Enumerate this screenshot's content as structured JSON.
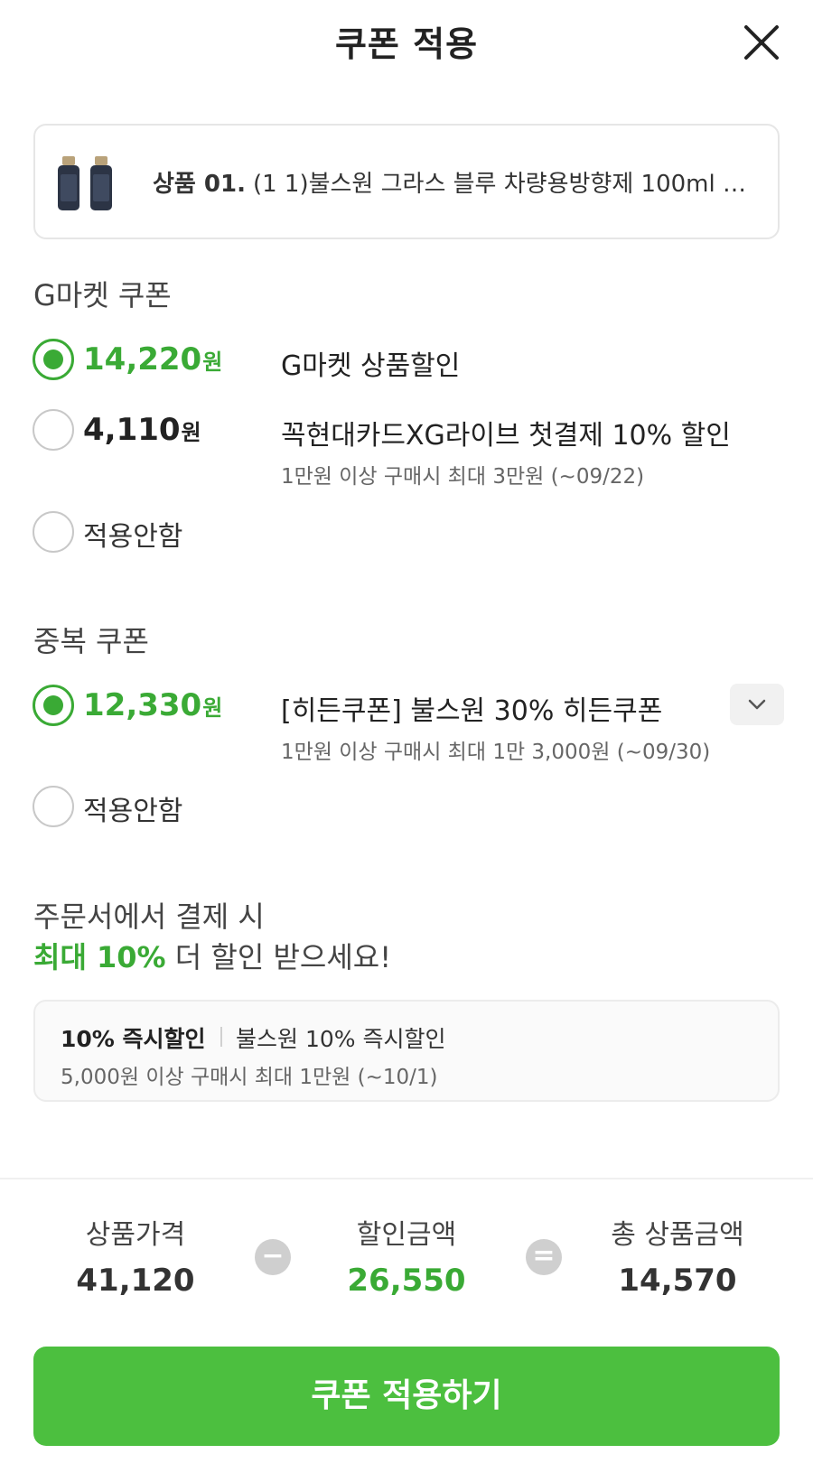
{
  "header": {
    "title": "쿠폰 적용"
  },
  "product": {
    "number": "상품 01.",
    "name": "(1 1)불스원 그라스 블루 차량용방향제 100ml 향..."
  },
  "gmarket_section": {
    "title": "G마켓 쿠폰",
    "options": [
      {
        "amount": "14,220",
        "unit": "원",
        "name": "G마켓 상품할인",
        "sub": "",
        "selected": true
      },
      {
        "amount": "4,110",
        "unit": "원",
        "name": "꼭현대카드XG라이브 첫결제 10% 할인",
        "sub": "1만원 이상 구매시 최대 3만원 (~09/22)",
        "selected": false
      }
    ],
    "none_label": "적용안함"
  },
  "duplicate_section": {
    "title": "중복 쿠폰",
    "options": [
      {
        "amount": "12,330",
        "unit": "원",
        "name": "[히든쿠폰] 불스원 30% 히든쿠폰",
        "sub": "1만원 이상 구매시 최대 1만 3,000원 (~09/30)",
        "selected": true
      }
    ],
    "none_label": "적용안함"
  },
  "promo": {
    "line1": "주문서에서 결제 시",
    "highlight": "최대 10%",
    "line2_rest": " 더 할인 받으세요!"
  },
  "benefit": {
    "title": "10% 즉시할인",
    "desc": "불스원 10% 즉시할인",
    "sub": "5,000원 이상 구매시 최대 1만원 (~10/1)"
  },
  "summary": {
    "price_label": "상품가격",
    "price_value": "41,120",
    "minus": "−",
    "discount_label": "할인금액",
    "discount_value": "26,550",
    "equals": "=",
    "total_label": "총 상품금액",
    "total_value": "14,570"
  },
  "apply_button": {
    "label": "쿠폰 적용하기"
  },
  "colors": {
    "accent": "#3aaa35",
    "button": "#4cbf3f"
  }
}
